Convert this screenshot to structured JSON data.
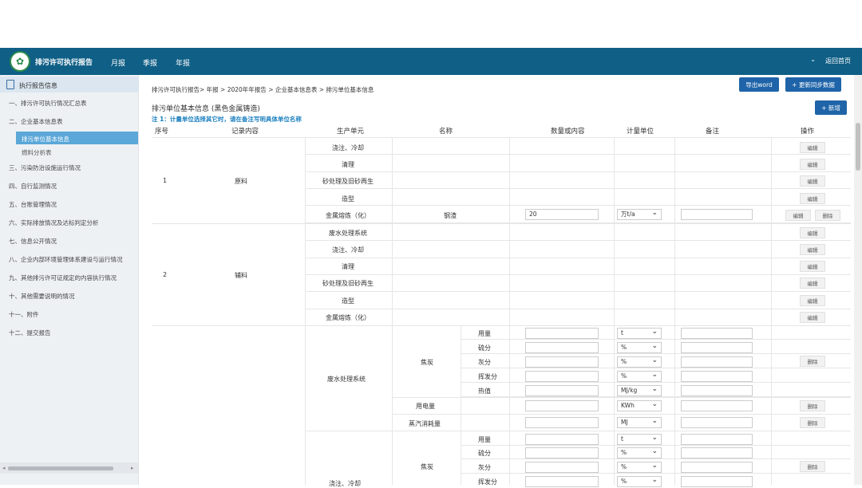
{
  "header": {
    "app_title": "排污许可执行报告",
    "nav": [
      "月报",
      "季报",
      "年报"
    ],
    "back_label": "返回首页",
    "chevron": "⌄"
  },
  "sidebar": {
    "head": "执行报告信息",
    "items": [
      "一、排污许可执行情况汇总表",
      "二、企业基本信息表",
      "排污单位基本信息",
      "燃料分析表",
      "三、污染防治设施运行情况",
      "四、自行监测情况",
      "五、台账管理情况",
      "六、实际排放情况及达标判定分析",
      "七、信息公开情况",
      "八、企业内部环境管理体系建设与运行情况",
      "九、其他排污许可证规定的内容执行情况",
      "十、其他需要说明的情况",
      "十一、附件",
      "十二、提交报告"
    ]
  },
  "main": {
    "breadcrumb": "排污许可执行报告> 年报 > 2020年年报告 > 企业基本信息表 > 排污单位基本信息",
    "title": "排污单位基本信息 (黑色金属铸造)",
    "note": "注 1：计量单位选择其它时，请在备注写明具体单位名称",
    "export_label": "导出word",
    "sync_label": "+ 更新同步数据",
    "add_label": "+ 新增"
  },
  "table": {
    "headers": [
      "序号",
      "记录内容",
      "生产单元",
      "名称",
      "数量或内容",
      "计量单位",
      "备注",
      "操作"
    ],
    "group1": {
      "no": "1",
      "type": "原料",
      "units": [
        "浇注、冷却",
        "清理",
        "砂处理及旧砂再生",
        "造型",
        "金属熔炼（化）"
      ],
      "name": "钢渣",
      "qty": "20",
      "unit": "万t/a"
    },
    "group2": {
      "no": "2",
      "type": "辅料",
      "units": [
        "废水处理系统",
        "浇注、冷却",
        "清理",
        "砂处理及旧砂再生",
        "造型",
        "金属熔炼（化）"
      ]
    },
    "group3": {
      "unit_name": "废水处理系统",
      "fuel": "焦炭",
      "props": [
        "用量",
        "硫分",
        "灰分",
        "挥发分",
        "热值"
      ],
      "prop_units": [
        "t",
        "%",
        "%",
        "%",
        "MJ/kg"
      ],
      "elec": "用电量",
      "elec_unit": "KWh",
      "steam": "蒸汽消耗量",
      "steam_unit": "MJ"
    },
    "group4": {
      "unit_name": "浇注、冷却",
      "fuel": "焦炭",
      "props": [
        "用量",
        "硫分",
        "灰分",
        "挥发分"
      ],
      "prop_units": [
        "t",
        "%",
        "%",
        "%"
      ]
    },
    "edit": "编辑",
    "delete": "删除"
  }
}
